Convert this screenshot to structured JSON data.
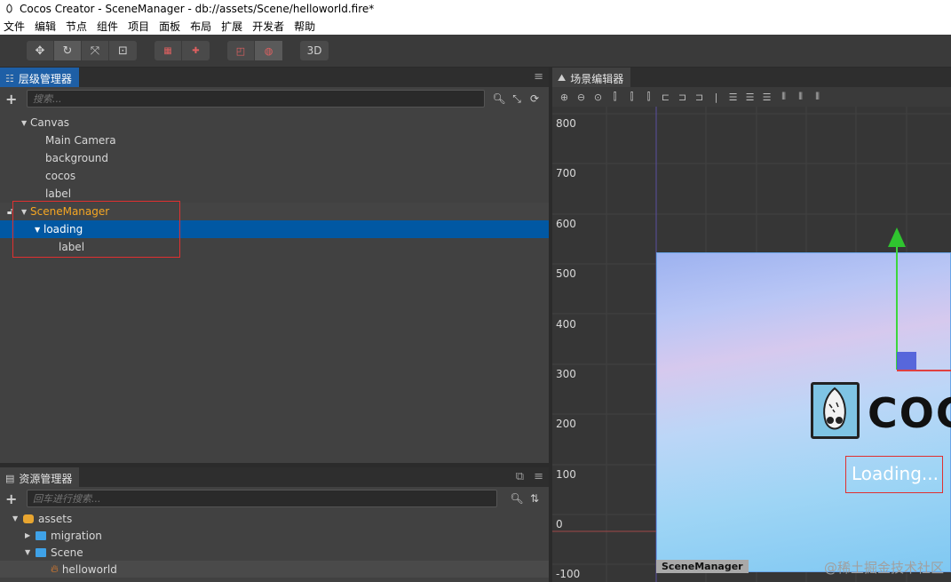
{
  "titlebar": {
    "title": "Cocos Creator - SceneManager - db://assets/Scene/helloworld.fire*"
  },
  "menu": [
    "文件",
    "编辑",
    "节点",
    "组件",
    "项目",
    "面板",
    "布局",
    "扩展",
    "开发者",
    "帮助"
  ],
  "toolbar": {
    "three_d_label": "3D"
  },
  "hierarchy": {
    "tab_label": "层级管理器",
    "search_placeholder": "搜索...",
    "nodes": [
      {
        "label": "Canvas"
      },
      {
        "label": "Main Camera"
      },
      {
        "label": "background"
      },
      {
        "label": "cocos"
      },
      {
        "label": "label"
      },
      {
        "label": "SceneManager"
      },
      {
        "label": "loading"
      },
      {
        "label": "label"
      }
    ]
  },
  "assets": {
    "tab_label": "资源管理器",
    "search_placeholder": "回车进行搜索...",
    "items": [
      {
        "label": "assets"
      },
      {
        "label": "migration"
      },
      {
        "label": "Scene"
      },
      {
        "label": "helloworld"
      }
    ]
  },
  "scene": {
    "tab_label": "场景编辑器",
    "y_ticks": [
      "800",
      "700",
      "600",
      "500",
      "400",
      "300",
      "200",
      "100",
      "0",
      "-100"
    ],
    "loading_text": "Loading...",
    "canvas_label": "SceneManager",
    "logo_text": "COCO"
  },
  "watermark": "@稀土掘金技术社区",
  "colors": {
    "selection": "#0158a3",
    "orange": "#f5a623",
    "tab_blue": "#1e5fa6",
    "highlight_box": "#e03030"
  }
}
